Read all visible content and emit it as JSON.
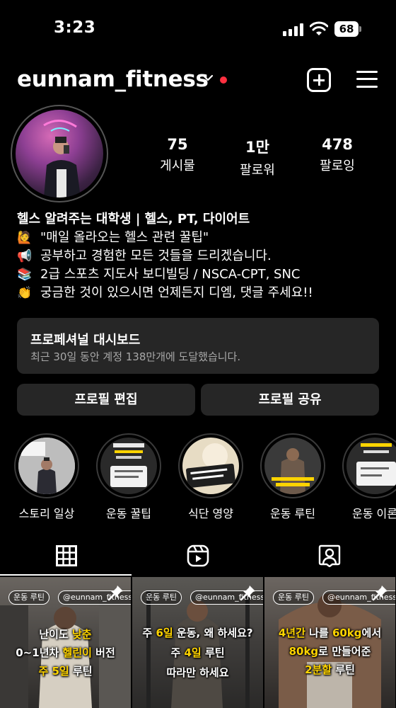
{
  "status_bar": {
    "time": "3:23",
    "battery": "68"
  },
  "header": {
    "username": "eunnam_fitness"
  },
  "profile": {
    "stats": [
      {
        "value": "75",
        "label": "게시물"
      },
      {
        "value": "1만",
        "label": "팔로워"
      },
      {
        "value": "478",
        "label": "팔로잉"
      }
    ],
    "bio_name": "헬스 알려주는 대학생 | 헬스, PT, 다이어트",
    "bio_lines": [
      {
        "emoji": "🙋",
        "text": "\"매일 올라오는 헬스 관련 꿀팁\""
      },
      {
        "emoji": "📢",
        "text": "공부하고 경험한 모든 것들을 드리겠습니다."
      },
      {
        "emoji": "📚",
        "text": "2급 스포츠 지도사 보디빌딩 / NSCA-CPT, SNC"
      },
      {
        "emoji": "👏",
        "text": "궁금한 것이 있으시면 언제든지 디엠, 댓글 주세요!!"
      }
    ]
  },
  "dashboard": {
    "title": "프로페셔널 대시보드",
    "subtitle": "최근 30일 동안 계정 138만개에 도달했습니다."
  },
  "buttons": {
    "edit_profile": "프로필 편집",
    "share_profile": "프로필 공유"
  },
  "highlights": [
    {
      "label": "스토리 일상"
    },
    {
      "label": "운동 꿀팁"
    },
    {
      "label": "식단 영양"
    },
    {
      "label": "운동 루틴"
    },
    {
      "label": "운동 이론"
    }
  ],
  "posts": [
    {
      "tag": "운동 루틴",
      "handle": "@eunnam_fitness",
      "line1_a": "난이도 ",
      "line1_b": "낮춘",
      "line2_a": "0~1년차 ",
      "line2_b": "헬린이",
      "line2_c": " 버전",
      "line3_a": "주 5일",
      "line3_b": " 루틴"
    },
    {
      "tag": "운동 루틴",
      "handle": "@eunnam_fitness",
      "line1_a": "주 ",
      "line1_b": "6일",
      "line1_c": " 운동, 왜 하세요?",
      "line2_a": "주 ",
      "line2_b": "4일",
      "line2_c": " 루틴",
      "line3": "따라만 하세요"
    },
    {
      "tag": "운동 루틴",
      "handle": "@eunnam_fitness",
      "line1_a": "4년간",
      "line1_b": " 나를 ",
      "line1_c": "60kg",
      "line1_d": "에서",
      "line2_a": "80kg",
      "line2_b": "로 만들어준",
      "line3_a": "2분할",
      "line3_b": " 루틴"
    }
  ]
}
